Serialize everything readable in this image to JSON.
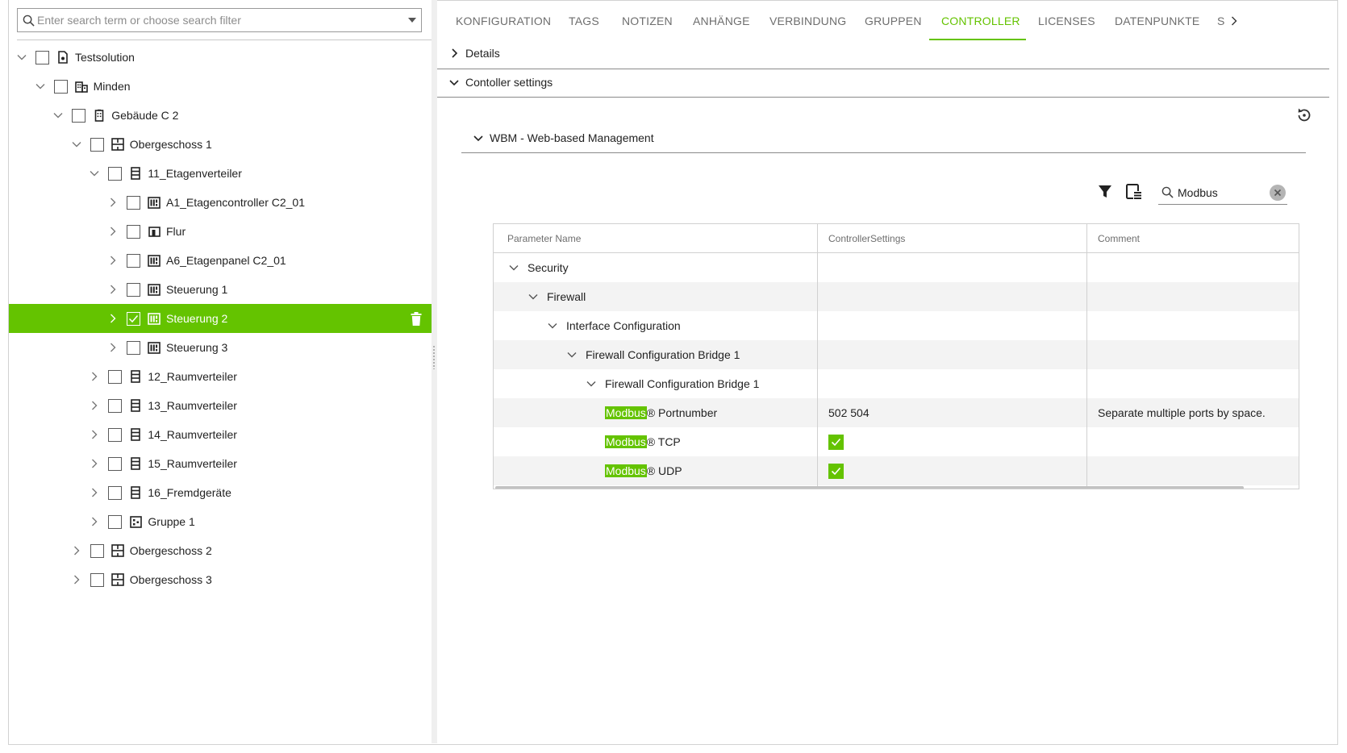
{
  "tree_search": {
    "placeholder": "Enter search term or choose search filter"
  },
  "tree": [
    {
      "label": "Testsolution",
      "icon": "solution-icon",
      "level": 0,
      "expanded": true,
      "checked": false
    },
    {
      "label": "Minden",
      "icon": "site-icon",
      "level": 1,
      "expanded": true,
      "checked": false
    },
    {
      "label": "Gebäude C 2",
      "icon": "building-icon",
      "level": 2,
      "expanded": true,
      "checked": false
    },
    {
      "label": "Obergeschoss 1",
      "icon": "floor-icon",
      "level": 3,
      "expanded": true,
      "checked": false
    },
    {
      "label": "11_Etagenverteiler",
      "icon": "cabinet-icon",
      "level": 4,
      "expanded": true,
      "checked": false
    },
    {
      "label": "A1_Etagencontroller C2_01",
      "icon": "controller-icon",
      "level": 5,
      "expanded": false,
      "checked": false
    },
    {
      "label": "Flur",
      "icon": "room-icon",
      "level": 5,
      "expanded": false,
      "checked": false
    },
    {
      "label": "A6_Etagenpanel C2_01",
      "icon": "controller-icon",
      "level": 5,
      "expanded": false,
      "checked": false
    },
    {
      "label": "Steuerung 1",
      "icon": "controller-icon",
      "level": 5,
      "expanded": false,
      "checked": false
    },
    {
      "label": "Steuerung 2",
      "icon": "controller-icon",
      "level": 5,
      "expanded": false,
      "checked": true,
      "selected": true
    },
    {
      "label": "Steuerung 3",
      "icon": "controller-icon",
      "level": 5,
      "expanded": false,
      "checked": false
    },
    {
      "label": "12_Raumverteiler",
      "icon": "cabinet-icon",
      "level": 4,
      "expanded": false,
      "checked": false
    },
    {
      "label": "13_Raumverteiler",
      "icon": "cabinet-icon",
      "level": 4,
      "expanded": false,
      "checked": false
    },
    {
      "label": "14_Raumverteiler",
      "icon": "cabinet-icon",
      "level": 4,
      "expanded": false,
      "checked": false
    },
    {
      "label": "15_Raumverteiler",
      "icon": "cabinet-icon",
      "level": 4,
      "expanded": false,
      "checked": false
    },
    {
      "label": "16_Fremdgeräte",
      "icon": "cabinet-icon",
      "level": 4,
      "expanded": false,
      "checked": false
    },
    {
      "label": "Gruppe 1",
      "icon": "group-icon",
      "level": 4,
      "expanded": false,
      "checked": false
    },
    {
      "label": "Obergeschoss 2",
      "icon": "floor-icon",
      "level": 3,
      "expanded": false,
      "checked": false
    },
    {
      "label": "Obergeschoss 3",
      "icon": "floor-icon",
      "level": 3,
      "expanded": false,
      "checked": false
    }
  ],
  "tabs": [
    {
      "label": "KONFIGURATION",
      "active": false
    },
    {
      "label": "TAGS",
      "active": false
    },
    {
      "label": "NOTIZEN",
      "active": false
    },
    {
      "label": "ANHÄNGE",
      "active": false
    },
    {
      "label": "VERBINDUNG",
      "active": false
    },
    {
      "label": "GRUPPEN",
      "active": false
    },
    {
      "label": "CONTROLLER",
      "active": true
    },
    {
      "label": "LICENSES",
      "active": false
    },
    {
      "label": "DATENPUNKTE",
      "active": false
    },
    {
      "label": "S",
      "active": false
    }
  ],
  "sections": {
    "details": "Details",
    "controller_settings": "Contoller settings",
    "wbm": "WBM - Web-based Management"
  },
  "filter_search": {
    "value": "Modbus"
  },
  "table": {
    "columns": [
      "Parameter Name",
      "ControllerSettings",
      "Comment"
    ],
    "rows": [
      {
        "name": "Security",
        "level": 0,
        "expandable": true,
        "value": "",
        "comment": ""
      },
      {
        "name": "Firewall",
        "level": 1,
        "expandable": true,
        "value": "",
        "comment": ""
      },
      {
        "name": "Interface Configuration",
        "level": 2,
        "expandable": true,
        "value": "",
        "comment": ""
      },
      {
        "name": "Firewall Configuration Bridge 1",
        "level": 3,
        "expandable": true,
        "value": "",
        "comment": ""
      },
      {
        "name": "Firewall Configuration Bridge 1",
        "level": 4,
        "expandable": true,
        "value": "",
        "comment": ""
      },
      {
        "highlight": "Modbus",
        "name": "® Portnumber",
        "level": 5,
        "expandable": false,
        "value": "502 504",
        "comment": "Separate multiple ports by space."
      },
      {
        "highlight": "Modbus",
        "name": "® TCP",
        "level": 5,
        "expandable": false,
        "value": "",
        "checkbox": true,
        "comment": ""
      },
      {
        "highlight": "Modbus",
        "name": "® UDP",
        "level": 5,
        "expandable": false,
        "value": "",
        "checkbox": true,
        "comment": ""
      }
    ]
  },
  "colors": {
    "accent": "#64c300",
    "text": "#222222",
    "muted": "#6e6e6e",
    "border": "#d0d0d0"
  }
}
